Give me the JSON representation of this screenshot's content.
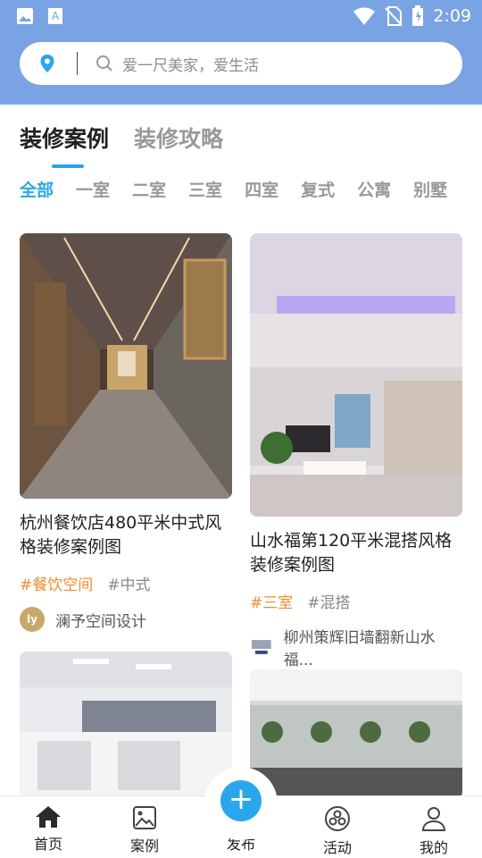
{
  "status": {
    "time": "2:09"
  },
  "search": {
    "placeholder": "爱一尺美家，爱生活"
  },
  "tabs": [
    {
      "label": "装修案例"
    },
    {
      "label": "装修攻略"
    }
  ],
  "categories": [
    "全部",
    "一室",
    "二室",
    "三室",
    "四室",
    "复式",
    "公寓",
    "别墅"
  ],
  "cards": [
    {
      "title": "杭州餐饮店480平米中式风格装修案例图",
      "tag1": "#餐饮空间",
      "tag2": "#中式",
      "author": "澜予空间设计"
    },
    {
      "title": "山水福第120平米混搭风格装修案例图",
      "tag1": "#三室",
      "tag2": "#混搭",
      "author": "柳州策辉旧墙翻新山水福..."
    }
  ],
  "bottom_nav": [
    {
      "label": "首页"
    },
    {
      "label": "案例"
    },
    {
      "label": "发布"
    },
    {
      "label": "活动"
    },
    {
      "label": "我的"
    }
  ],
  "colors": {
    "header": "#7aa3e3",
    "accent": "#2aa6ec",
    "tag": "#f08c2d"
  }
}
